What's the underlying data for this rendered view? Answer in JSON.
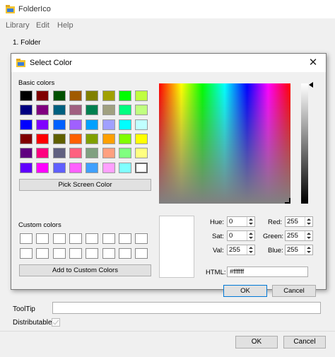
{
  "window": {
    "title": "FolderIco",
    "menu": [
      "Library",
      "Edit",
      "Help"
    ],
    "section_title": "1. Folder",
    "tooltip_label": "ToolTip",
    "distributable_label": "Distributable",
    "ok_label": "OK",
    "cancel_label": "Cancel"
  },
  "dialog": {
    "title": "Select Color",
    "basic_colors_label": "Basic colors",
    "basic_colors": [
      [
        "#000000",
        "#800000",
        "#005000",
        "#a05a00",
        "#808000",
        "#a0a000",
        "#00ff00",
        "#c0ff40"
      ],
      [
        "#000080",
        "#800080",
        "#006080",
        "#a06080",
        "#008050",
        "#a0a080",
        "#00ff80",
        "#c0ff80"
      ],
      [
        "#0000ff",
        "#8000ff",
        "#0060ff",
        "#a060ff",
        "#00a0ff",
        "#a0a0ff",
        "#00ffff",
        "#c0ffff"
      ],
      [
        "#800000",
        "#ff0000",
        "#606000",
        "#ff6000",
        "#80a000",
        "#ffa000",
        "#80ff00",
        "#ffff00"
      ],
      [
        "#600080",
        "#ff0080",
        "#606080",
        "#ff6080",
        "#80a080",
        "#ffa080",
        "#80ff80",
        "#ffff80"
      ],
      [
        "#6000ff",
        "#ff00ff",
        "#6060ff",
        "#ff60ff",
        "#40a0ff",
        "#ffa0ff",
        "#80ffff",
        "#ffffff"
      ]
    ],
    "selected_swatch": "#ffffff",
    "pick_screen_label": "Pick Screen Color",
    "custom_colors_label": "Custom colors",
    "add_custom_label": "Add to Custom Colors",
    "hue_label": "Hue:",
    "sat_label": "Sat:",
    "val_label": "Val:",
    "red_label": "Red:",
    "green_label": "Green:",
    "blue_label": "Blue:",
    "hue": "0",
    "sat": "0",
    "val": "255",
    "red": "255",
    "green": "255",
    "blue": "255",
    "html_label": "HTML:",
    "html_value": "#ffffff",
    "ok_label": "OK",
    "cancel_label": "Cancel"
  }
}
